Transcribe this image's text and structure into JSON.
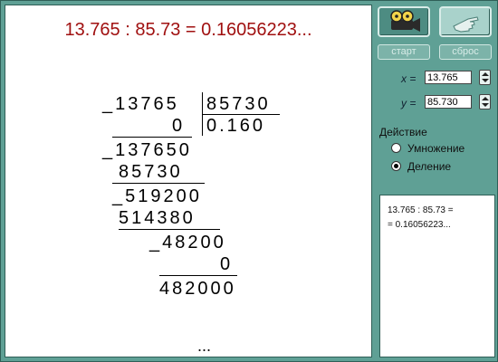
{
  "work": {
    "title": "13.765 : 85.73 = 0.16056223...",
    "lines": [
      "_13765",
      "0",
      "_137650",
      "85730",
      "_519200",
      "514380",
      "_48200",
      "0",
      "482000"
    ],
    "divisor": "85730",
    "quotient": "0.160",
    "ellipsis": "..."
  },
  "panel": {
    "start_label": "старт",
    "reset_label": "сброс",
    "x_label": "x =",
    "y_label": "y =",
    "x_value": "13.765",
    "y_value": "85.730",
    "action_label": "Действие",
    "options": [
      "Умножение",
      "Деление"
    ],
    "selected_option": "Деление",
    "result_line1": "13.765 : 85.73 =",
    "result_line2": "= 0.16056223..."
  },
  "colors": {
    "background": "#5fa095",
    "title": "#a01010",
    "workspace": "#ffffff"
  },
  "icons": {
    "start": "film-reel-icon",
    "reset": "hand-pointer-icon",
    "spin": "spinner-arrows-icon"
  }
}
